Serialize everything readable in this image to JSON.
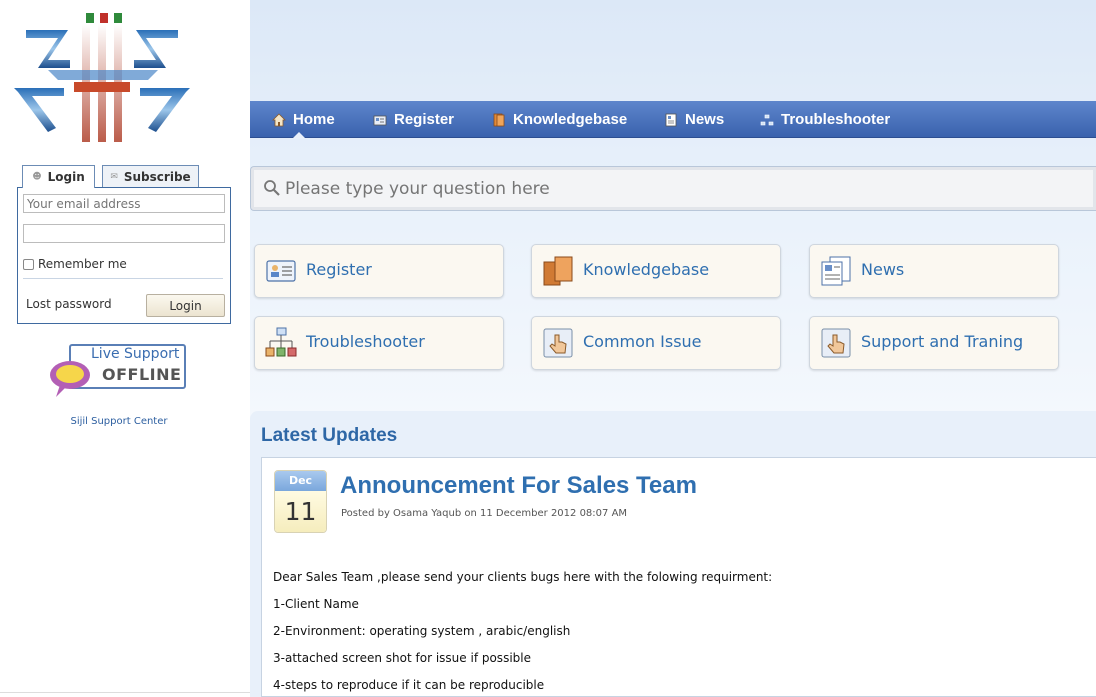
{
  "nav": {
    "items": [
      {
        "label": "Home",
        "icon": "home-icon"
      },
      {
        "label": "Register",
        "icon": "register-icon"
      },
      {
        "label": "Knowledgebase",
        "icon": "book-icon"
      },
      {
        "label": "News",
        "icon": "news-icon"
      },
      {
        "label": "Troubleshooter",
        "icon": "troubleshooter-icon"
      }
    ],
    "active": "Home"
  },
  "login": {
    "tab_login": "Login",
    "tab_subscribe": "Subscribe",
    "email_placeholder": "Your email address",
    "remember_label": "Remember me",
    "lost_password": "Lost password",
    "button": "Login"
  },
  "live_support": {
    "title": "Live Support",
    "status": "OFFLINE"
  },
  "sidebar_footer": "Sijil Support Center",
  "search": {
    "placeholder": "Please type your question here"
  },
  "tiles": [
    {
      "label": "Register",
      "icon": "register-card-icon"
    },
    {
      "label": "Knowledgebase",
      "icon": "books-icon"
    },
    {
      "label": "News",
      "icon": "newspaper-icon"
    },
    {
      "label": "Troubleshooter",
      "icon": "org-chart-icon"
    },
    {
      "label": "Common Issue",
      "icon": "hand-pointer-icon"
    },
    {
      "label": "Support and Traning",
      "icon": "hand-pointer-icon"
    }
  ],
  "updates": {
    "title": "Latest Updates",
    "article": {
      "month": "Dec",
      "day": "11",
      "title": "Announcement For Sales Team",
      "meta": "Posted by Osama Yaqub on 11 December 2012 08:07 AM",
      "body": [
        "Dear Sales Team ,please send your clients bugs here with the folowing requirment:",
        "1-Client Name",
        "2-Environment: operating system , arabic/english",
        "3-attached screen shot for issue if possible",
        "4-steps to reproduce if it can be reproducible"
      ]
    }
  },
  "colors": {
    "nav_bg": "#4a72bb",
    "link": "#2f6fb0",
    "tile_bg": "#fbf8f1"
  }
}
